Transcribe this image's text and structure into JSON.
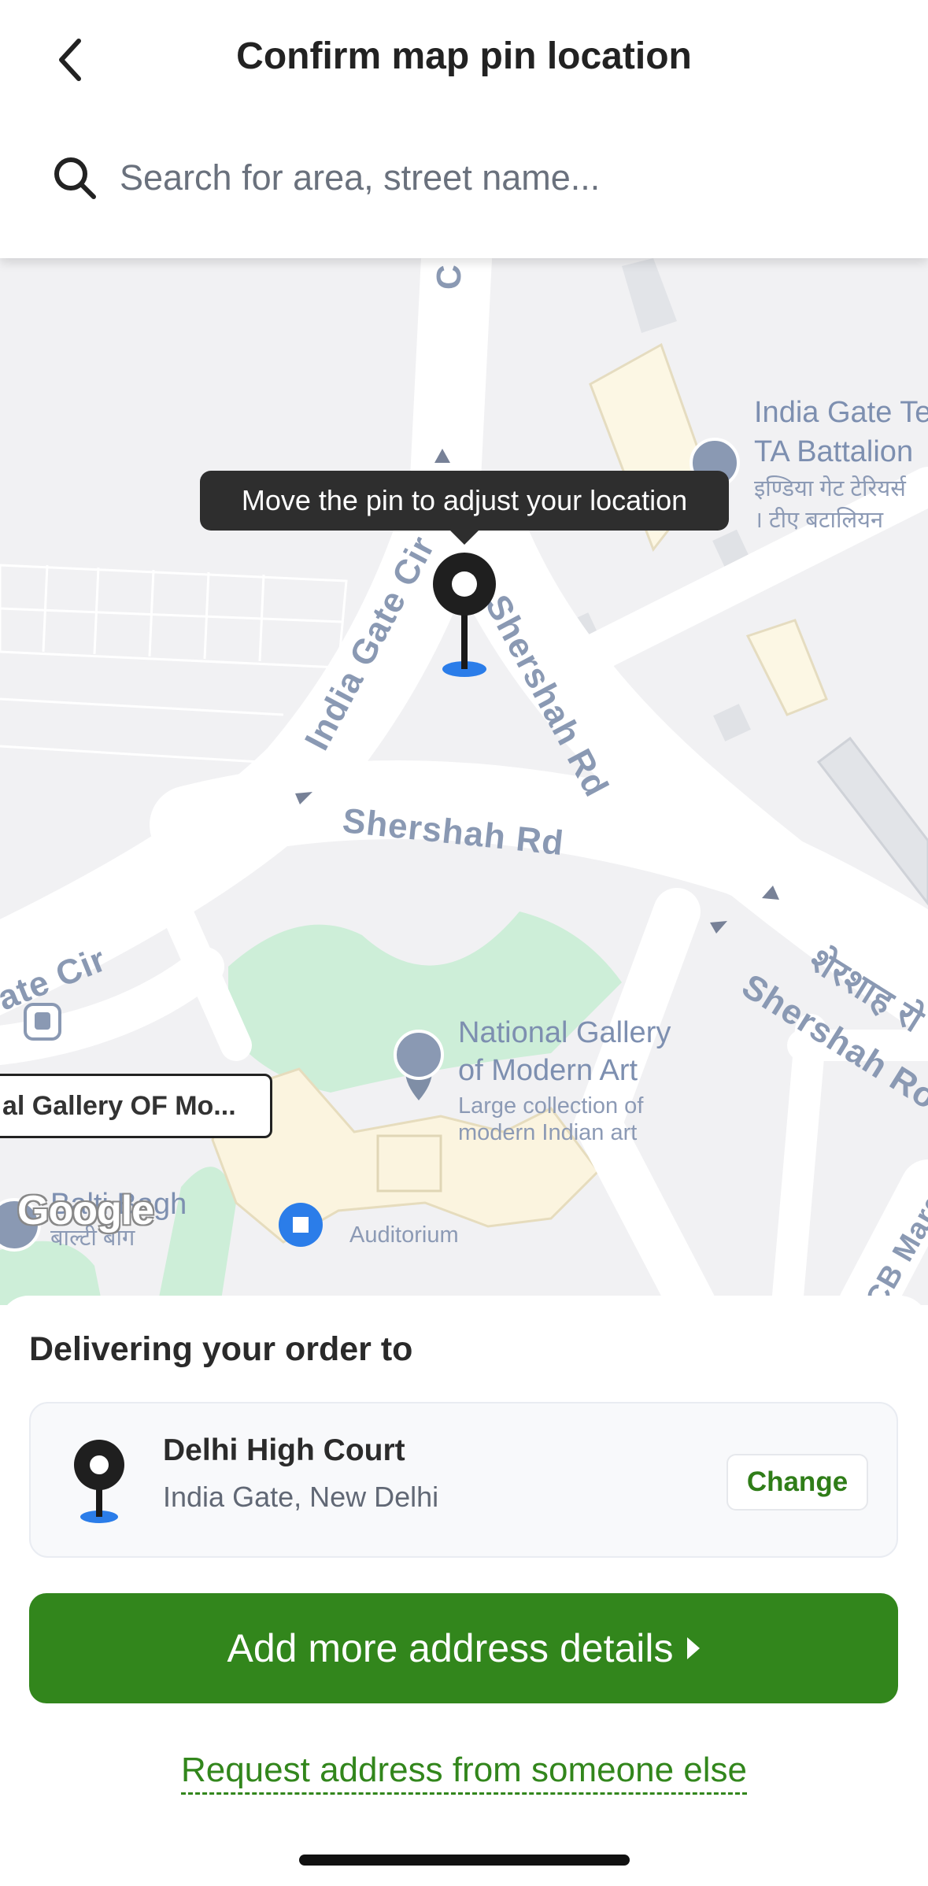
{
  "header": {
    "title": "Confirm map pin location",
    "back_icon": "chevron-left-icon",
    "search_placeholder": "Search for area, street name..."
  },
  "map": {
    "tooltip": "Move the pin to adjust your location",
    "roads": {
      "c_hexagon": "C - He",
      "india_gate_cir_top": "India Gate Cir",
      "shershah_rd_right": "Shershah Rd",
      "shershah_rd_center": "Shershah Rd",
      "gate_cir_left": "ate Cir",
      "shershah_rd_lower": "Shershah Ro",
      "shershah_hindi": "शेरशाह रो",
      "cb_marg": "CB Marg"
    },
    "pois": {
      "india_gate_line1": "India Gate Te",
      "india_gate_line2": "TA Battalion",
      "india_gate_hindi1": "इण्डिया गेट टेरियर्स",
      "india_gate_hindi2": "। टीए बटालियन",
      "ngma_line1": "National Gallery",
      "ngma_line2": "of Modern Art",
      "ngma_sub1": "Large collection of",
      "ngma_sub2": "modern Indian art",
      "baltibagh": "Balti Bagh",
      "baltibagh_hindi": "बाल्टी बाग",
      "auditorium": "Auditorium"
    },
    "callout": "al Gallery OF Mo...",
    "attribution": "Google"
  },
  "sheet": {
    "title": "Delivering your order to",
    "address_name": "Delhi High Court",
    "address_sub": "India Gate, New Delhi",
    "change_label": "Change",
    "primary_label": "Add more address details",
    "link_label": "Request address from someone else"
  },
  "colors": {
    "brand_green": "#32861c",
    "pin_blue": "#2b7de9",
    "map_bg": "#f1f1f3",
    "park_green": "#cdeed8"
  }
}
